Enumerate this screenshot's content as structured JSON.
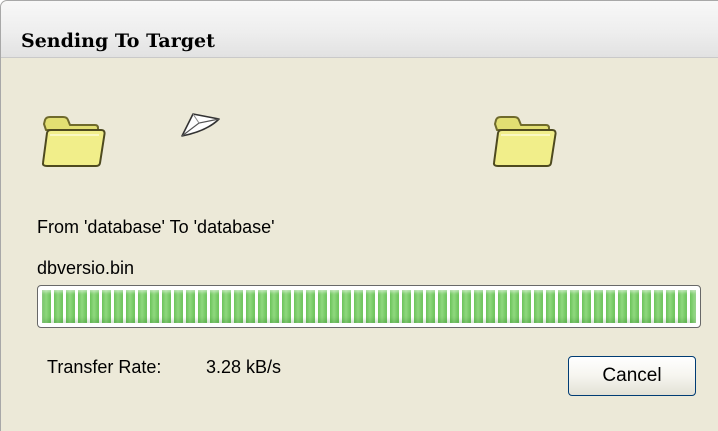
{
  "window": {
    "title": "Sending To Target"
  },
  "icons": {
    "source": "folder-icon",
    "transfer": "flying-paper-icon",
    "destination": "folder-icon"
  },
  "transfer": {
    "route_text": "From 'database' To 'database'",
    "filename": "dbversio.bin",
    "progress_fraction": 1.0,
    "rate_label": "Transfer Rate:",
    "rate_value": "3.28 kB/s"
  },
  "buttons": {
    "cancel_label": "Cancel"
  },
  "colors": {
    "progress_green": "#71c660",
    "folder_yellow": "#f1ee8a",
    "window_background": "#ece9d8"
  }
}
